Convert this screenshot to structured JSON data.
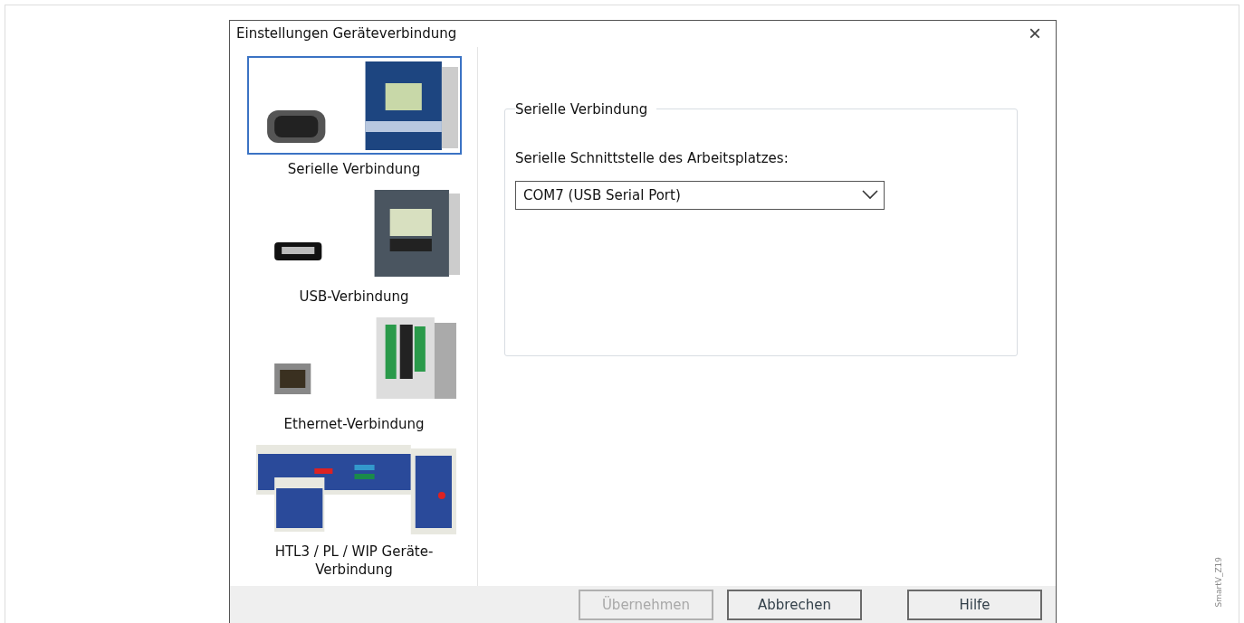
{
  "dialog": {
    "title": "Einstellungen Geräteverbindung",
    "close": "×"
  },
  "connections": [
    {
      "label": "Serielle Verbindung",
      "selected": true,
      "kind": "picture"
    },
    {
      "label": "USB-Verbindung",
      "selected": false,
      "kind": "picture"
    },
    {
      "label": "Ethernet-Verbindung",
      "selected": false,
      "kind": "picture"
    },
    {
      "label": "HTL3 / PL / WIP Geräte-Verbindung",
      "selected": false,
      "kind": "picture"
    }
  ],
  "group": {
    "title": "Serielle Verbindung",
    "field_label": "Serielle Schnittstelle des Arbeitsplatzes:",
    "port": {
      "value": "COM7 (USB Serial Port)"
    }
  },
  "buttons": [
    {
      "label": "Übernehmen",
      "disabled": true
    },
    {
      "label": "Abbrechen",
      "disabled": false
    },
    {
      "label": "Hilfe",
      "disabled": false
    }
  ],
  "figure_id": "SmartV_Z19"
}
